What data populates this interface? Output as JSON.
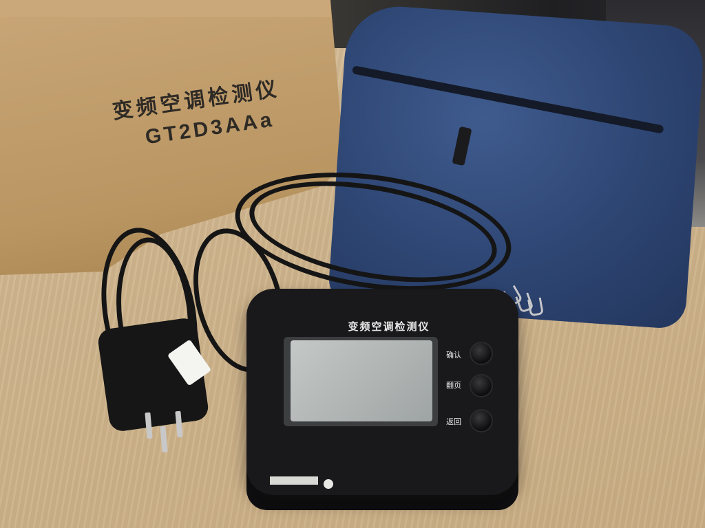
{
  "box": {
    "title": "变频空调检测仪",
    "model": "GT2D3AAa"
  },
  "device": {
    "title": "变频空调检测仪",
    "buttons": [
      {
        "label": "确认"
      },
      {
        "label": "翻页"
      },
      {
        "label": "返回"
      }
    ]
  },
  "colors": {
    "bag": "#2f4775",
    "table": "#cfb58d",
    "cardboard": "#b99562",
    "device": "#19191b",
    "lcd": "#b3b8b6"
  },
  "icons": {
    "logo": "circle-logo-icon"
  }
}
